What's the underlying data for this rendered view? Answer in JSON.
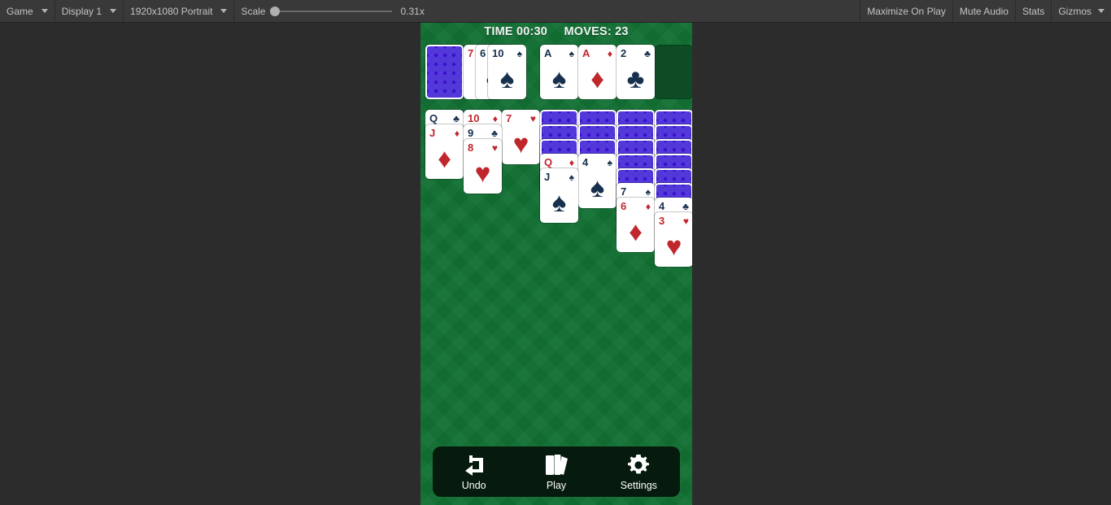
{
  "editor_toolbar": {
    "left": [
      {
        "name": "view-mode-dropdown",
        "label": "Game",
        "has_caret": true
      },
      {
        "name": "display-dropdown",
        "label": "Display 1",
        "has_caret": true
      },
      {
        "name": "resolution-dropdown",
        "label": "1920x1080 Portrait",
        "has_caret": true
      }
    ],
    "scale": {
      "label": "Scale",
      "value": "0.31x"
    },
    "right": [
      {
        "name": "maximize-on-play-toggle",
        "label": "Maximize On Play"
      },
      {
        "name": "mute-audio-toggle",
        "label": "Mute Audio"
      },
      {
        "name": "stats-toggle",
        "label": "Stats"
      },
      {
        "name": "gizmos-toggle",
        "label": "Gizmos"
      }
    ]
  },
  "game": {
    "hud": {
      "time_label": "TIME 00:30",
      "moves_label": "MOVES: 23"
    },
    "colors": {
      "table_green": "#127034",
      "empty_slot_green": "#0d4c24",
      "card_back_blue": "#3a0fd0",
      "red_suit": "#c0272d",
      "black_suit": "#16304e",
      "bottom_bar": "#061a0d"
    },
    "stock": {
      "name": "stock-pile",
      "face_down_count": 1
    },
    "waste": {
      "name": "waste-pile",
      "cards": [
        {
          "rank": "7",
          "suit": "♦",
          "color": "red"
        },
        {
          "rank": "6",
          "suit": "♣",
          "color": "black"
        },
        {
          "rank": "10",
          "suit": "♠",
          "color": "black"
        }
      ]
    },
    "foundations": [
      {
        "name": "foundation-spades",
        "rank": "A",
        "suit": "♠",
        "color": "black",
        "empty": false
      },
      {
        "name": "foundation-diamonds",
        "rank": "A",
        "suit": "♦",
        "color": "red",
        "empty": false
      },
      {
        "name": "foundation-clubs",
        "rank": "2",
        "suit": "♣",
        "color": "black",
        "empty": false
      },
      {
        "name": "foundation-hearts",
        "rank": "",
        "suit": "",
        "color": "",
        "empty": true
      }
    ],
    "tableau": [
      {
        "name": "tableau-column-1",
        "face_down": 0,
        "face_up": [
          {
            "rank": "Q",
            "suit": "♣",
            "color": "black"
          },
          {
            "rank": "J",
            "suit": "♦",
            "color": "red"
          }
        ]
      },
      {
        "name": "tableau-column-2",
        "face_down": 0,
        "face_up": [
          {
            "rank": "10",
            "suit": "♦",
            "color": "red"
          },
          {
            "rank": "9",
            "suit": "♣",
            "color": "black"
          },
          {
            "rank": "8",
            "suit": "♥",
            "color": "red"
          }
        ]
      },
      {
        "name": "tableau-column-3",
        "face_down": 0,
        "face_up": [
          {
            "rank": "7",
            "suit": "♥",
            "color": "red"
          }
        ]
      },
      {
        "name": "tableau-column-4",
        "face_down": 3,
        "face_up": [
          {
            "rank": "Q",
            "suit": "♦",
            "color": "red"
          },
          {
            "rank": "J",
            "suit": "♠",
            "color": "black"
          }
        ]
      },
      {
        "name": "tableau-column-5",
        "face_down": 3,
        "face_up": [
          {
            "rank": "4",
            "suit": "♠",
            "color": "black"
          }
        ]
      },
      {
        "name": "tableau-column-6",
        "face_down": 5,
        "face_up": [
          {
            "rank": "7",
            "suit": "♠",
            "color": "black"
          },
          {
            "rank": "6",
            "suit": "♦",
            "color": "red"
          }
        ]
      },
      {
        "name": "tableau-column-7",
        "face_down": 6,
        "face_up": [
          {
            "rank": "4",
            "suit": "♣",
            "color": "black"
          },
          {
            "rank": "3",
            "suit": "♥",
            "color": "red"
          }
        ]
      }
    ],
    "bottom_bar": [
      {
        "name": "undo-button",
        "label": "Undo",
        "icon": "undo-arrow-icon"
      },
      {
        "name": "play-button",
        "label": "Play",
        "icon": "cards-fan-icon"
      },
      {
        "name": "settings-button",
        "label": "Settings",
        "icon": "gear-icon"
      }
    ]
  }
}
